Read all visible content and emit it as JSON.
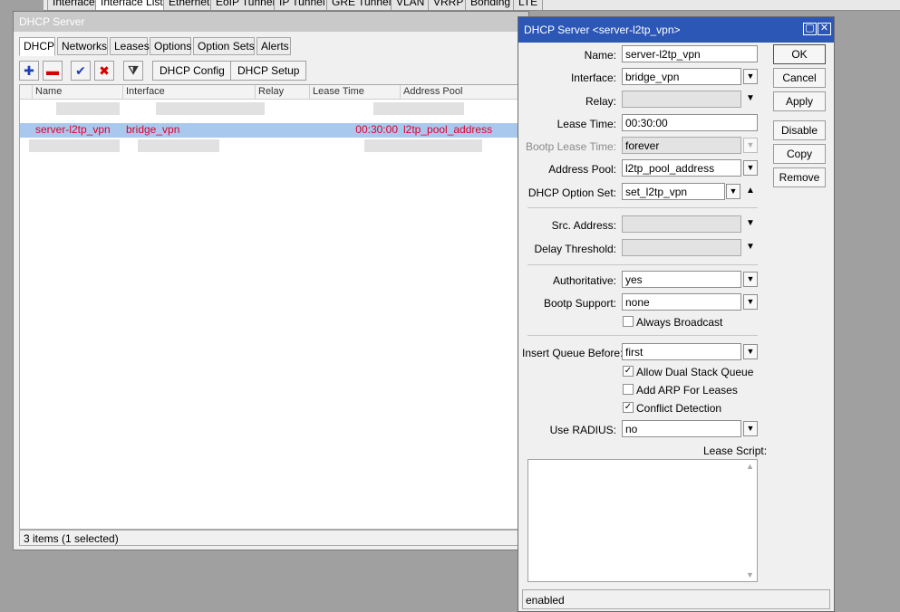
{
  "top_tabs": [
    "Interface",
    "Interface List",
    "Ethernet",
    "EoIP Tunnel",
    "IP Tunnel",
    "GRE Tunnel",
    "VLAN",
    "VRRP",
    "Bonding",
    "LTE"
  ],
  "main_window": {
    "title": "DHCP Server",
    "tabs": [
      "DHCP",
      "Networks",
      "Leases",
      "Options",
      "Option Sets",
      "Alerts"
    ],
    "toolbar": {
      "add_icon": "plus-icon",
      "remove_icon": "minus-icon",
      "enable_icon": "checkmark-icon",
      "disable_icon": "x-icon",
      "filter_icon": "filter-icon",
      "dhcp_config_label": "DHCP Config",
      "dhcp_setup_label": "DHCP Setup"
    },
    "columns": [
      "Name",
      "Interface",
      "Relay",
      "Lease Time",
      "Address Pool"
    ],
    "selected_row": {
      "name": "server-l2tp_vpn",
      "interface": "bridge_vpn",
      "relay": "",
      "lease_time": "00:30:00",
      "address_pool": "l2tp_pool_address"
    },
    "status": "3 items (1 selected)"
  },
  "dialog": {
    "title": "DHCP Server <server-l2tp_vpn>",
    "fields": {
      "name": {
        "label": "Name:",
        "value": "server-l2tp_vpn"
      },
      "interface": {
        "label": "Interface:",
        "value": "bridge_vpn"
      },
      "relay": {
        "label": "Relay:",
        "value": ""
      },
      "lease_time": {
        "label": "Lease Time:",
        "value": "00:30:00"
      },
      "bootp_lease_time": {
        "label": "Bootp Lease Time:",
        "value": "forever"
      },
      "address_pool": {
        "label": "Address Pool:",
        "value": "l2tp_pool_address"
      },
      "dhcp_option_set": {
        "label": "DHCP Option Set:",
        "value": "set_l2tp_vpn"
      },
      "src_address": {
        "label": "Src. Address:",
        "value": ""
      },
      "delay_threshold": {
        "label": "Delay Threshold:",
        "value": ""
      },
      "authoritative": {
        "label": "Authoritative:",
        "value": "yes"
      },
      "bootp_support": {
        "label": "Bootp Support:",
        "value": "none"
      },
      "insert_queue_before": {
        "label": "Insert Queue Before:",
        "value": "first"
      },
      "use_radius": {
        "label": "Use RADIUS:",
        "value": "no"
      },
      "lease_script": {
        "label": "Lease Script:",
        "value": ""
      }
    },
    "checkboxes": {
      "always_broadcast": {
        "label": "Always Broadcast",
        "checked": false
      },
      "allow_dual_stack_queue": {
        "label": "Allow Dual Stack Queue",
        "checked": true
      },
      "add_arp_for_leases": {
        "label": "Add ARP For Leases",
        "checked": false
      },
      "conflict_detection": {
        "label": "Conflict Detection",
        "checked": true
      }
    },
    "buttons": {
      "ok": "OK",
      "cancel": "Cancel",
      "apply": "Apply",
      "disable": "Disable",
      "copy": "Copy",
      "remove": "Remove"
    },
    "status": "enabled"
  },
  "colors": {
    "dialog_titlebar": "#2c57b7",
    "selected_row": "#a9c8ee",
    "row_text": "#e0002a"
  }
}
